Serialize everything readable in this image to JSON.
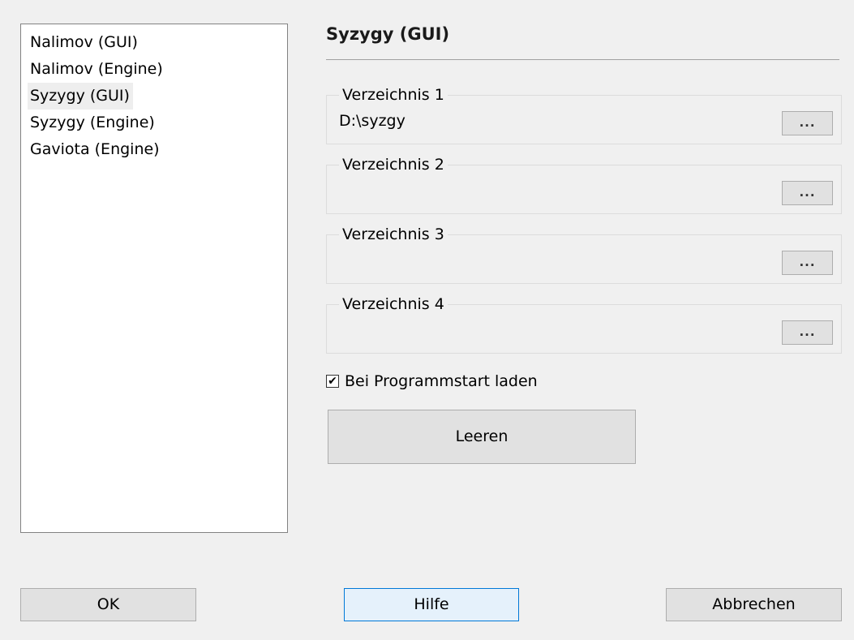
{
  "tablebase_list": {
    "items": [
      {
        "label": "Nalimov (GUI)",
        "selected": false
      },
      {
        "label": "Nalimov (Engine)",
        "selected": false
      },
      {
        "label": "Syzygy (GUI)",
        "selected": true
      },
      {
        "label": "Syzygy (Engine)",
        "selected": false
      },
      {
        "label": "Gaviota (Engine)",
        "selected": false
      }
    ]
  },
  "panel": {
    "title": "Syzygy (GUI)",
    "directories": [
      {
        "label": "Verzeichnis 1",
        "value": "D:\\syzgy",
        "browse_label": "..."
      },
      {
        "label": "Verzeichnis 2",
        "value": "",
        "browse_label": "..."
      },
      {
        "label": "Verzeichnis 3",
        "value": "",
        "browse_label": "..."
      },
      {
        "label": "Verzeichnis 4",
        "value": "",
        "browse_label": "..."
      }
    ],
    "load_on_start": {
      "label": "Bei Programmstart laden",
      "checked": true,
      "check_glyph": "✔"
    },
    "clear_label": "Leeren"
  },
  "footer": {
    "ok_label": "OK",
    "help_label": "Hilfe",
    "cancel_label": "Abbrechen"
  }
}
